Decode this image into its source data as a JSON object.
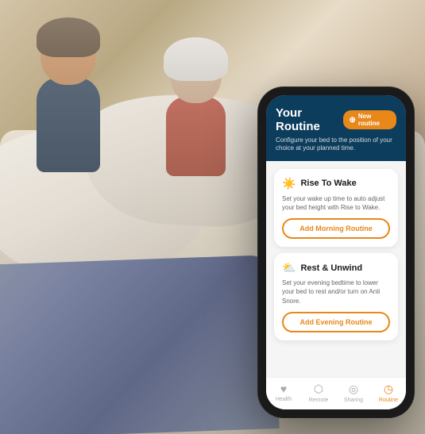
{
  "background": {
    "description": "Couple in bed smiling"
  },
  "phone": {
    "header": {
      "title": "Your Routine",
      "new_routine_label": "New routine",
      "subtitle": "Configure your bed to the position of your choice at your planned time."
    },
    "cards": [
      {
        "id": "morning",
        "icon": "☀️",
        "title": "Rise To Wake",
        "description": "Set your wake up time to auto adjust your bed height with Rise to Wake.",
        "button_label": "Add Morning Routine"
      },
      {
        "id": "evening",
        "icon": "☁️",
        "title": "Rest & Unwind",
        "description": "Set your evening bedtime to lower your bed to rest and/or turn on Anti Snore.",
        "button_label": "Add Evening Routine"
      }
    ],
    "nav": [
      {
        "id": "health",
        "icon": "♥",
        "label": "Health",
        "active": false
      },
      {
        "id": "remote",
        "icon": "⊡",
        "label": "Remote",
        "active": false
      },
      {
        "id": "sharing",
        "icon": "⊗",
        "label": "Sharing",
        "active": false
      },
      {
        "id": "routine",
        "icon": "◷",
        "label": "Routine",
        "active": true
      }
    ]
  }
}
